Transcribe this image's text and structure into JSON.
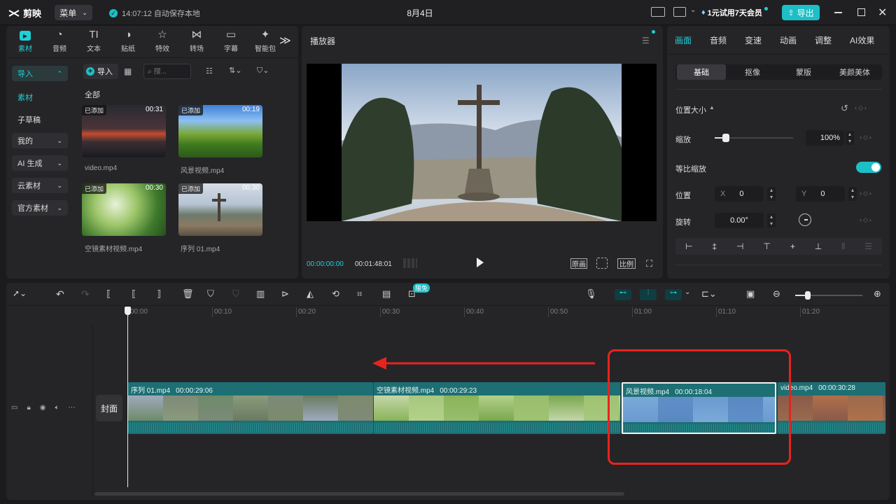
{
  "app": {
    "name": "剪映",
    "menu_label": "菜单",
    "autosave": "14:07:12 自动保存本地",
    "project_title": "8月4日",
    "vip_label": "1元试用7天会员",
    "export_label": "导出",
    "accent": "#1dbfc7"
  },
  "media_panel": {
    "tabs": [
      {
        "label": "素材",
        "icon": "media-icon"
      },
      {
        "label": "音频",
        "icon": "audio-icon"
      },
      {
        "label": "文本",
        "icon": "text-icon"
      },
      {
        "label": "贴纸",
        "icon": "sticker-icon"
      },
      {
        "label": "特效",
        "icon": "effect-icon"
      },
      {
        "label": "转场",
        "icon": "transition-icon"
      },
      {
        "label": "字幕",
        "icon": "caption-icon"
      },
      {
        "label": "智能包",
        "icon": "smart-icon"
      }
    ],
    "sidebar": {
      "import": "导入",
      "items": [
        "素材",
        "子草稿"
      ],
      "groups": [
        "我的",
        "AI 生成",
        "云素材",
        "官方素材"
      ]
    },
    "import_button": "导入",
    "search_placeholder": "搜...",
    "section_title": "全部",
    "files": [
      {
        "name": "video.mp4",
        "tag": "已添加",
        "duration": "00:31"
      },
      {
        "name": "风景视频.mp4",
        "tag": "已添加",
        "duration": "00:19"
      },
      {
        "name": "空镜素材视频.mp4",
        "tag": "已添加",
        "duration": "00:30"
      },
      {
        "name": "序列 01.mp4",
        "tag": "已添加",
        "duration": "00:30"
      }
    ]
  },
  "player": {
    "title": "播放器",
    "current_time": "00:00:00:00",
    "total_time": "00:01:48:01",
    "btn_original": "原画",
    "btn_ratio": "比例"
  },
  "properties": {
    "tabs": [
      "画面",
      "音频",
      "变速",
      "动画",
      "调整",
      "AI效果"
    ],
    "segments": [
      "基础",
      "抠像",
      "蒙版",
      "美颜美体"
    ],
    "section": "位置大小",
    "scale_label": "缩放",
    "scale_value": "100%",
    "scale_level": 0.12,
    "uniform_label": "等比缩放",
    "position_label": "位置",
    "x_label": "X",
    "x_value": "0",
    "y_label": "Y",
    "y_value": "0",
    "rotation_label": "旋转",
    "rotation_value": "0.00°"
  },
  "timeline": {
    "free_badge": "限免",
    "cover_label": "封面",
    "ruler": [
      "00:00",
      "00:10",
      "00:20",
      "00:30",
      "00:40",
      "00:50",
      "01:00",
      "01:10",
      "01:20"
    ],
    "clips": [
      {
        "name": "序列 01.mp4",
        "duration": "00:00:29:06"
      },
      {
        "name": "空镜素材视频.mp4",
        "duration": "00:00:29:23"
      },
      {
        "name": "风景视频.mp4",
        "duration": "00:00:18:04"
      },
      {
        "name": "video.mp4",
        "duration": "00:00:30:28"
      }
    ]
  },
  "colors": {
    "highlight": "#e8231f",
    "track": "#1d6f73",
    "accent": "#1fd0d8"
  }
}
